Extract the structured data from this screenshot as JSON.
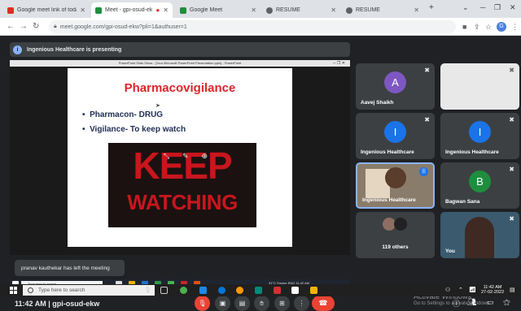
{
  "browser": {
    "tabs": [
      {
        "label": "Google meet link of today p",
        "favicon_color": "#d93025"
      },
      {
        "label": "Meet - gpi-osud-ekw",
        "favicon_color": "#1e8e3e"
      },
      {
        "label": "Google Meet",
        "favicon_color": "#1e8e3e"
      },
      {
        "label": "RESUME",
        "favicon_color": "#5f6368"
      },
      {
        "label": "RESUME",
        "favicon_color": "#5f6368"
      }
    ],
    "new_tab": "+",
    "url": "meet.google.com/gpi-osud-ekw?pli=1&authuser=1",
    "profile_initial": "G"
  },
  "meet": {
    "banner": "Ingenious Healthcare is presenting",
    "slide": {
      "title": "Pharmacovigilance",
      "bullets": [
        "Pharmacon- DRUG",
        "Vigilance- To keep watch"
      ],
      "image_line1": "KEEP",
      "image_line2": "WATCHING",
      "window_title": "PowerPoint Slide Show - [Your Microsoft PowerPoint Presentation.pptx] - PowerPoint"
    },
    "toast": "pranav kauthekar has left the meeting",
    "inner_taskbar": {
      "search": "Type here to search",
      "tray": "31°C Smoke  ENG  11:42 AM"
    },
    "participants": [
      {
        "name": "Aavej Shaikh",
        "initial": "A",
        "color": "#7e57c2"
      },
      {
        "name": "Ingenious Healthcare",
        "initial": "I",
        "color": "#1a73e8"
      },
      {
        "name": "Ingenious Healthcare",
        "initial": "I",
        "color": "#1a73e8"
      },
      {
        "name": "Ingenious Healthcare",
        "initial": ""
      },
      {
        "name": "Bagwan Sana",
        "initial": "B",
        "color": "#1e8e3e"
      },
      {
        "name": "119 others",
        "initial": ""
      },
      {
        "name": "You",
        "initial": ""
      }
    ],
    "meeting_time": "11:42 AM",
    "meeting_code": "gpi-osud-ekw",
    "separator": "|",
    "activate_line1": "Activate Windows",
    "activate_line2": "Go to Settings to activate Windows."
  },
  "taskbar": {
    "search": "Type here to search",
    "time": "11:42 AM",
    "date": "27-02-2022"
  }
}
